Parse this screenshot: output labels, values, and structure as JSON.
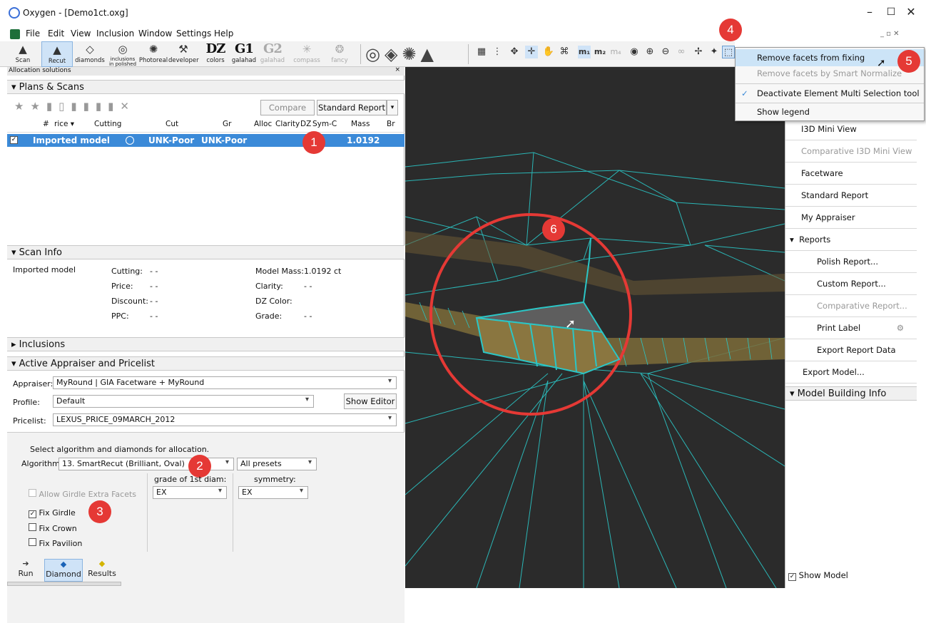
{
  "window": {
    "title": "Oxygen - [Demo1ct.oxg]",
    "min": "–",
    "max": "☐",
    "close": "✕"
  },
  "menu": [
    "File",
    "Edit",
    "View",
    "Inclusion",
    "Window",
    "Settings",
    "Help"
  ],
  "toolbar": {
    "buttons": [
      {
        "label": "Scan",
        "icon": "▲"
      },
      {
        "label": "Recut",
        "icon": "▲"
      },
      {
        "label": "diamonds",
        "icon": "◇"
      },
      {
        "label": "inclusions\nin polished",
        "icon": "◎"
      },
      {
        "label": "Photoreal",
        "icon": "✺"
      },
      {
        "label": "developer",
        "icon": "⚒"
      }
    ],
    "big": [
      {
        "t": "DZ",
        "s": "colors"
      },
      {
        "t": "G1",
        "s": "galahad"
      },
      {
        "t": "G2",
        "s": "galahad"
      }
    ],
    "compass": "compass",
    "fancy": "fancy"
  },
  "alloc": {
    "header": "Allocation solutions",
    "close": "×",
    "plans_title": "Plans & Scans",
    "compare": "Compare",
    "std_report": "Standard Report",
    "columns": [
      "#",
      "rice ▾",
      "Cutting",
      "Cut",
      "Gr",
      "Alloc",
      "Clarity",
      "DZ",
      "Sym-C",
      "Mass",
      "Br"
    ],
    "row": {
      "name": "Imported model",
      "cut": "UNK-Poor",
      "gr": "UNK-Poor",
      "mass": "1.0192"
    }
  },
  "scaninfo": {
    "title": "Scan Info",
    "model": "Imported model",
    "cutting_l": "Cutting:",
    "cutting_v": "- -",
    "price_l": "Price:",
    "price_v": "- -",
    "discount_l": "Discount:",
    "discount_v": "- -",
    "ppc_l": "PPC:",
    "ppc_v": "- -",
    "mass_l": "Model Mass:",
    "mass_v": "1.0192 ct",
    "clarity_l": "Clarity:",
    "clarity_v": "- -",
    "dz_l": "DZ Color:",
    "grade_l": "Grade:",
    "grade_v": "- -"
  },
  "inclusions": {
    "title": "Inclusions"
  },
  "appraiser": {
    "title": "Active Appraiser and Pricelist",
    "appraiser_l": "Appraiser:",
    "appraiser_v": "MyRound | GIA Facetware + MyRound",
    "profile_l": "Profile:",
    "profile_v": "Default",
    "show_editor": "Show Editor",
    "pricelist_l": "Pricelist:",
    "pricelist_v": "LEXUS_PRICE_09MARCH_2012"
  },
  "algo": {
    "intro": "Select algorithm and diamonds for allocation.",
    "algo_l": "Algorithm",
    "algo_v": "13. SmartRecut (Brilliant, Oval)",
    "presets": "All presets",
    "grade_l": "grade of 1st diam:",
    "grade_v": "EX",
    "sym_l": "symmetry:",
    "sym_v": "EX",
    "allow_girdle": "Allow Girdle Extra Facets",
    "fix_girdle": "Fix Girdle",
    "fix_crown": "Fix Crown",
    "fix_pavilion": "Fix Pavilion"
  },
  "bottom": {
    "run": "Run",
    "diamond": "Diamond",
    "results": "Results"
  },
  "context": {
    "items": [
      "Remove facets from fixing",
      "Remove facets by Smart Normalize",
      "Deactivate Element Multi Selection tool",
      "Show legend"
    ]
  },
  "rightpane": {
    "items": [
      "I3D Mini View",
      "Comparative I3D Mini View",
      "Facetware",
      "Standard Report",
      "My Appraiser",
      "Reports",
      "Polish Report...",
      "Custom Report...",
      "Comparative Report...",
      "Print Label",
      "Export Report Data",
      "Export Model..."
    ],
    "mbi": "Model Building Info",
    "show_model": "Show Model"
  },
  "badges": [
    "1",
    "2",
    "3",
    "4",
    "5",
    "6"
  ],
  "colors": {
    "accent": "#3b8ad8",
    "badge": "#e53935",
    "mesh": "#2bc6c6",
    "girdle": "#7d6c3a"
  }
}
